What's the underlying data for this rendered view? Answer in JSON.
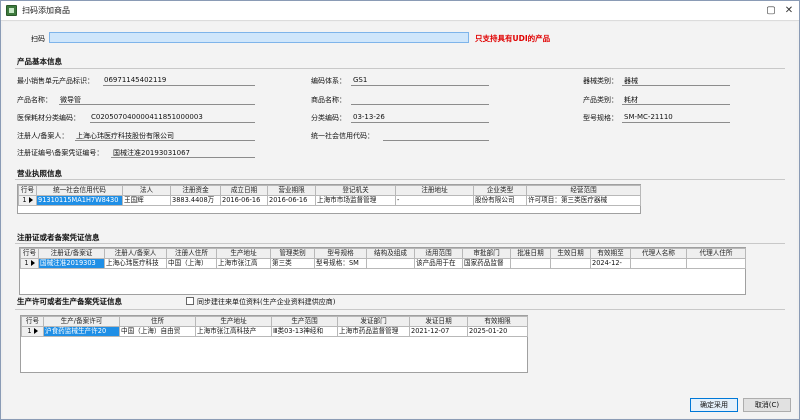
{
  "window": {
    "title": "扫码添加商品"
  },
  "scan": {
    "label": "扫码",
    "value": "",
    "hint": "只支持具有UDI的产品"
  },
  "product_basic": {
    "section_title": "产品基本信息",
    "fields": {
      "min_unit_id_label": "最小销售单元产品标识：",
      "min_unit_id": "06971145402119",
      "coding_system_label": "编码体系：",
      "coding_system": "GS1",
      "device_category_label": "器械类别：",
      "device_category": "器械",
      "product_name_label": "产品名称：",
      "product_name": "微导管",
      "trade_name_label": "商品名称：",
      "trade_name": "",
      "product_category_label": "产品类别：",
      "product_category": "耗材",
      "medical_code_label": "医保耗材分类编码：",
      "medical_code": "C020507040000411851000003",
      "class_code_label": "分类编码：",
      "class_code": "03-13-26",
      "model_label": "型号规格：",
      "model": "SM-MC-21110",
      "registrant_label": "注册人/备案人：",
      "registrant": "上海心玮医疗科技股份有限公司",
      "credit_code_label": "统一社会信用代码：",
      "credit_code": "",
      "cert_no_label": "注册证编号\\备案凭证编号：",
      "cert_no": "国械注准20193031067"
    }
  },
  "business_license": {
    "section_title": "营业执照信息",
    "columns": [
      "行号",
      "统一社会信用代码",
      "法人",
      "注册资金",
      "成立日期",
      "营业期限",
      "登记机关",
      "注册地址",
      "企业类型",
      "经营范围"
    ],
    "rows": [
      [
        "1",
        "91310115MA1H7W8430",
        "王国辉",
        "3883.4408万",
        "2016-06-16",
        "2016-06-16",
        "上海市市场监督管理",
        "-",
        "股份有限公司",
        "许可项目：第三类医疗器械"
      ]
    ]
  },
  "registration_cert": {
    "section_title": "注册证或者备案凭证信息",
    "columns": [
      "行号",
      "注册证/备案证",
      "注册人/备案人",
      "注册人住所",
      "生产地址",
      "管理类别",
      "型号规格",
      "结构及组成",
      "适用范围",
      "审批部门",
      "批准日期",
      "生效日期",
      "有效期至",
      "代理人名称",
      "代理人住所"
    ],
    "rows": [
      [
        "1",
        "国械注准2019303",
        "上海心玮医疗科技",
        "中国（上海）",
        "上海市张江高",
        "第三类",
        "型号规格：SM",
        "",
        "该产品用于在",
        "国家药品监督",
        "",
        "",
        "2024-12-",
        "",
        ""
      ]
    ]
  },
  "production_license": {
    "section_title": "生产许可或者生产备案凭证信息",
    "sync_checkbox_label": "同步建往来单位资料(生产企业资料建供应商)",
    "sync_checked": false,
    "columns": [
      "行号",
      "生产/备案许可",
      "住所",
      "生产地址",
      "生产范围",
      "发证部门",
      "发证日期",
      "有效期限"
    ],
    "rows": [
      [
        "1",
        "沪食药监械生产许20",
        "中国（上海）自由贸",
        "上海市张江高科技产",
        "Ⅲ类03-13神经和",
        "上海市药品监督管理",
        "2021-12-07",
        "2025-01-20"
      ]
    ]
  },
  "buttons": {
    "confirm": "确定采用",
    "cancel": "取消(C)"
  },
  "colors": {
    "hint": "#e00000",
    "selection": "#1f8fe6",
    "scan_bg": "#cfe6fb"
  }
}
